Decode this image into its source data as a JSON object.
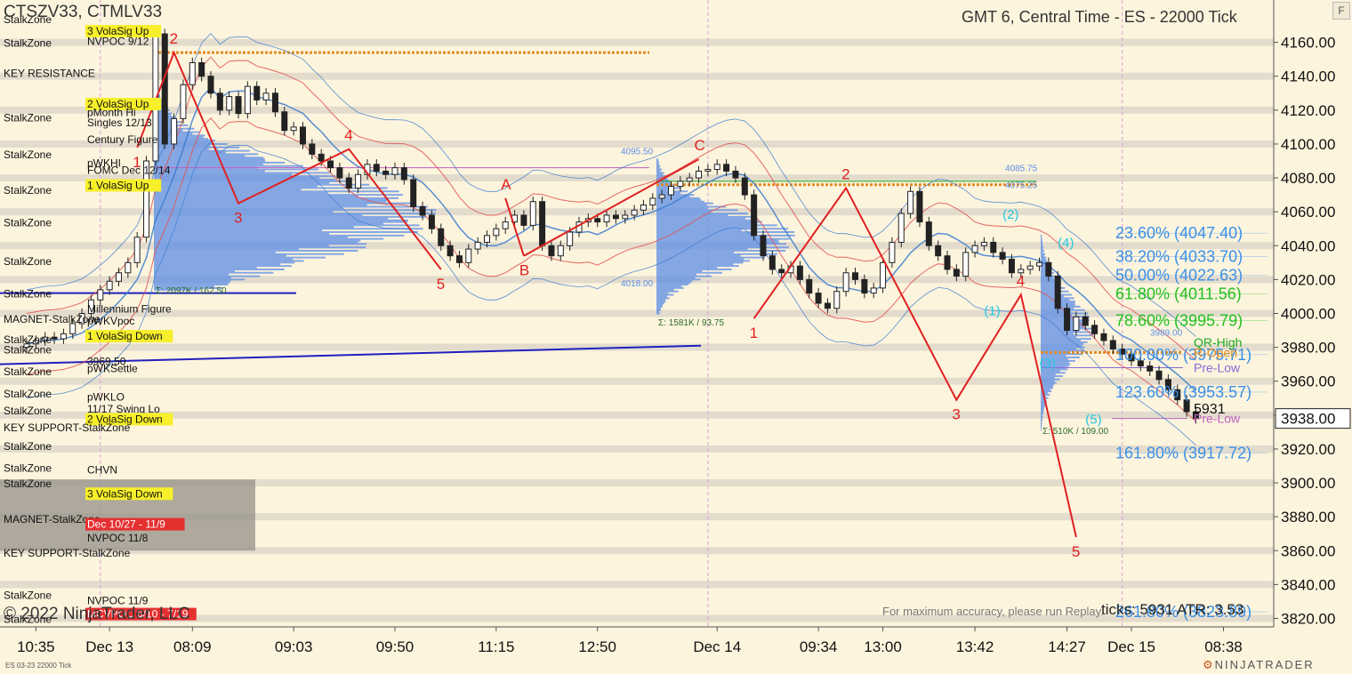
{
  "header": {
    "instrument": "CTSZV33, CTMLV33",
    "right_title": "GMT 6, Central Time - ES - 22000 Tick",
    "f_button": "F"
  },
  "footer": {
    "copyright": "© 2022 NinjaTrader, LLC",
    "accuracy_note": "For maximum accuracy, please run Replay.",
    "ticks_atr": "ticks: 5931   ATR: 3.53",
    "instrument_small": "ES 03-23 22000 Tick",
    "brand": "NINJATRADER"
  },
  "colors": {
    "background": "#fdf4dd",
    "candle": "#222222",
    "zigzag": "#e02020",
    "fib_blue": "#3a8fe8",
    "fib_green": "#22c022",
    "volume_profile": "#5b8ee6",
    "price_tag": "#ffffff"
  },
  "chart_data": {
    "type": "candlestick",
    "ylim": [
      3815,
      4185
    ],
    "y_ticks": [
      4160,
      4140,
      4120,
      4100,
      4080,
      4060,
      4040,
      4020,
      4000,
      3980,
      3960,
      3940,
      3920,
      3900,
      3880,
      3860,
      3840,
      3820
    ],
    "y_tick_labels": [
      "4160.00",
      "4140.00",
      "4120.00",
      "4100.00",
      "4080.00",
      "4060.00",
      "4040.00",
      "4020.00",
      "4000.00",
      "3980.00",
      "3960.00",
      "3940.00",
      "3920.00",
      "3900.00",
      "3880.00",
      "3860.00",
      "3840.00",
      "3820.00"
    ],
    "x_labels": [
      {
        "label": "10:35",
        "bar": 1
      },
      {
        "label": "Dec 13",
        "bar": 9
      },
      {
        "label": "08:09",
        "bar": 18
      },
      {
        "label": "09:03",
        "bar": 29
      },
      {
        "label": "09:50",
        "bar": 40
      },
      {
        "label": "11:15",
        "bar": 51
      },
      {
        "label": "12:50",
        "bar": 62
      },
      {
        "label": "Dec 14",
        "bar": 75
      },
      {
        "label": "09:34",
        "bar": 86
      },
      {
        "label": "13:00",
        "bar": 93
      },
      {
        "label": "13:42",
        "bar": 103
      },
      {
        "label": "14:27",
        "bar": 113
      },
      {
        "label": "Dec 15",
        "bar": 120
      },
      {
        "label": "08:38",
        "bar": 130
      }
    ],
    "session_breaks": [
      8,
      74,
      119
    ],
    "last_price": "3938.00",
    "closes": [
      3982,
      3984,
      3986,
      3985,
      3988,
      3994,
      4000,
      4008,
      4014,
      4019,
      4024,
      4030,
      4045,
      4090,
      4165,
      4100,
      4115,
      4135,
      4148,
      4140,
      4130,
      4120,
      4128,
      4118,
      4134,
      4126,
      4130,
      4119,
      4108,
      4110,
      4100,
      4094,
      4090,
      4086,
      4080,
      4074,
      4082,
      4088,
      4084,
      4082,
      4086,
      4079,
      4063,
      4058,
      4050,
      4040,
      4034,
      4030,
      4038,
      4042,
      4046,
      4050,
      4054,
      4058,
      4052,
      4066,
      4040,
      4034,
      4040,
      4048,
      4054,
      4056,
      4054,
      4058,
      4056,
      4058,
      4061,
      4064,
      4068,
      4070,
      4075,
      4078,
      4080,
      4084,
      4085,
      4088,
      4084,
      4080,
      4070,
      4046,
      4034,
      4026,
      4024,
      4028,
      4020,
      4012,
      4006,
      4003,
      4013,
      4024,
      4020,
      4012,
      4015,
      4030,
      4042,
      4059,
      4072,
      4054,
      4040,
      4034,
      4026,
      4022,
      4036,
      4040,
      4042,
      4036,
      4032,
      4024,
      4026,
      4028,
      4030,
      4022,
      4003,
      3990,
      3998,
      3993,
      3988,
      3984,
      3979,
      3976,
      3972,
      3969,
      3966,
      3961,
      3955,
      3949,
      3942,
      3938
    ],
    "zigzags": [
      {
        "points": [
          [
            12,
            4098
          ],
          [
            16,
            4154
          ],
          [
            23,
            4065
          ],
          [
            35,
            4097
          ],
          [
            45,
            4026
          ]
        ],
        "labels": [
          "1",
          "2",
          "3",
          "4",
          "5"
        ]
      },
      {
        "points": [
          [
            52,
            4068
          ],
          [
            54,
            4034
          ]
        ],
        "labels": [
          "A",
          "B"
        ]
      },
      {
        "points": [
          [
            54,
            4034
          ],
          [
            73,
            4091
          ]
        ],
        "labels": [
          "",
          "C"
        ]
      },
      {
        "points": [
          [
            79,
            3997
          ],
          [
            89,
            4074
          ],
          [
            101,
            3949
          ],
          [
            108,
            4011
          ],
          [
            114,
            3868
          ]
        ],
        "labels": [
          "1",
          "2",
          "3",
          "4",
          "5"
        ]
      }
    ],
    "wave_labels_cyan": [
      "(1)",
      "(2)",
      "(3)",
      "(4)",
      "(5)"
    ],
    "fib_levels": [
      {
        "label": "23.60% (4047.40)",
        "value": 4047.4,
        "color": "#3a8fe8"
      },
      {
        "label": "38.20% (4033.70)",
        "value": 4033.7,
        "color": "#3a8fe8"
      },
      {
        "label": "50.00% (4022.63)",
        "value": 4022.63,
        "color": "#3a8fe8"
      },
      {
        "label": "61.80% (4011.56)",
        "value": 4011.56,
        "color": "#22c022"
      },
      {
        "label": "78.60% (3995.79)",
        "value": 3995.79,
        "color": "#22c022"
      },
      {
        "label": "100.00% (3975.71)",
        "value": 3975.71,
        "color": "#3a8fe8"
      },
      {
        "label": "123.60% (3953.57)",
        "value": 3953.57,
        "color": "#3a8fe8"
      },
      {
        "label": "161.80% (3917.72)",
        "value": 3917.72,
        "color": "#3a8fe8"
      },
      {
        "label": "261.80% (3823.89)",
        "value": 3823.89,
        "color": "#3a8fe8"
      }
    ],
    "key_levels": [
      {
        "label": "QR-High",
        "value": 3983,
        "color": "#22a822"
      },
      {
        "label": "R-Open",
        "value": 3977,
        "color": "#e08a20"
      },
      {
        "label": "Pre-Low",
        "value": 3968,
        "color": "#8a6ad8"
      },
      {
        "label": "Pre-Low",
        "value": 3938,
        "color": "#c060c0"
      }
    ],
    "profile_labels": [
      {
        "label": "4095.50",
        "value": 4096
      },
      {
        "label": "4085.75",
        "value": 4086
      },
      {
        "label": "4075.25",
        "value": 4076
      },
      {
        "label": "4018.00",
        "value": 4018
      },
      {
        "label": "3989.00",
        "value": 3989
      },
      {
        "label": "Σ: 2097K / 162.50",
        "value": 4014
      },
      {
        "label": "Σ: 1581K / 93.75",
        "value": 3995
      },
      {
        "label": "Σ: 510K / 109.00",
        "value": 3931
      }
    ],
    "price_box": "5931",
    "left_labels": [
      {
        "label": "StalkZone",
        "value": 4172,
        "bg": ""
      },
      {
        "label": "3 VolaSig Up",
        "value": 4165,
        "bg": "#f6ef2a"
      },
      {
        "label": "NVPOC 9/12",
        "value": 4159,
        "bg": ""
      },
      {
        "label": "StalkZone",
        "value": 4158,
        "bg": ""
      },
      {
        "label": "KEY RESISTANCE",
        "value": 4140,
        "bg": ""
      },
      {
        "label": "2 VolaSig Up",
        "value": 4122,
        "bg": "#f6ef2a"
      },
      {
        "label": "pMonth Hi",
        "value": 4117,
        "bg": ""
      },
      {
        "label": "StalkZone",
        "value": 4114,
        "bg": ""
      },
      {
        "label": "Singles 12/13",
        "value": 4111,
        "bg": ""
      },
      {
        "label": "Century Figure",
        "value": 4101,
        "bg": ""
      },
      {
        "label": "StalkZone",
        "value": 4092,
        "bg": ""
      },
      {
        "label": "pWKHI",
        "value": 4087,
        "bg": ""
      },
      {
        "label": "FOMC Dec 12/14",
        "value": 4083,
        "bg": ""
      },
      {
        "label": "1 VolaSig Up",
        "value": 4074,
        "bg": "#f6ef2a"
      },
      {
        "label": "StalkZone",
        "value": 4071,
        "bg": ""
      },
      {
        "label": "StalkZone",
        "value": 4052,
        "bg": ""
      },
      {
        "label": "StalkZone",
        "value": 4029,
        "bg": ""
      },
      {
        "label": "StalkZone",
        "value": 4010,
        "bg": ""
      },
      {
        "label": "Millennium Figure",
        "value": 4001,
        "bg": ""
      },
      {
        "label": "MAGNET-StalkZone",
        "value": 3995,
        "bg": ""
      },
      {
        "label": "pWKVpoc",
        "value": 3994,
        "bg": ""
      },
      {
        "label": "1 VolaSig Down",
        "value": 3985,
        "bg": "#f6ef2a"
      },
      {
        "label": "StalkZone",
        "value": 3983,
        "bg": ""
      },
      {
        "label": "StalkZone",
        "value": 3977,
        "bg": ""
      },
      {
        "label": "3969.50",
        "value": 3970,
        "bg": ""
      },
      {
        "label": "pWKSettle",
        "value": 3966,
        "bg": ""
      },
      {
        "label": "StalkZone",
        "value": 3964,
        "bg": ""
      },
      {
        "label": "StalkZone",
        "value": 3951,
        "bg": ""
      },
      {
        "label": "pWKLO",
        "value": 3949,
        "bg": ""
      },
      {
        "label": "11/17 Swing Lo",
        "value": 3942,
        "bg": ""
      },
      {
        "label": "StalkZone",
        "value": 3941,
        "bg": ""
      },
      {
        "label": "2 VolaSig Down",
        "value": 3936,
        "bg": "#f6ef2a"
      },
      {
        "label": "KEY SUPPORT-StalkZone",
        "value": 3931,
        "bg": ""
      },
      {
        "label": "StalkZone",
        "value": 3920,
        "bg": ""
      },
      {
        "label": "StalkZone",
        "value": 3907,
        "bg": ""
      },
      {
        "label": "CHVN",
        "value": 3906,
        "bg": ""
      },
      {
        "label": "StalkZone",
        "value": 3898,
        "bg": ""
      },
      {
        "label": "3 VolaSig Down",
        "value": 3892,
        "bg": "#f6ef2a"
      },
      {
        "label": "MAGNET-StalkZone",
        "value": 3877,
        "bg": ""
      },
      {
        "label": "Dec 10/27 - 11/9",
        "value": 3874,
        "bg": "#e53030"
      },
      {
        "label": "NVPOC 11/8",
        "value": 3866,
        "bg": ""
      },
      {
        "label": "KEY SUPPORT-StalkZone",
        "value": 3857,
        "bg": ""
      },
      {
        "label": "StalkZone",
        "value": 3832,
        "bg": ""
      },
      {
        "label": "NVPOC 11/9",
        "value": 3829,
        "bg": ""
      },
      {
        "label": "MCVPOC 6/10 - 7/19",
        "value": 3821,
        "bg": "#e53030"
      },
      {
        "label": "StalkZone",
        "value": 3818,
        "bg": ""
      }
    ]
  }
}
